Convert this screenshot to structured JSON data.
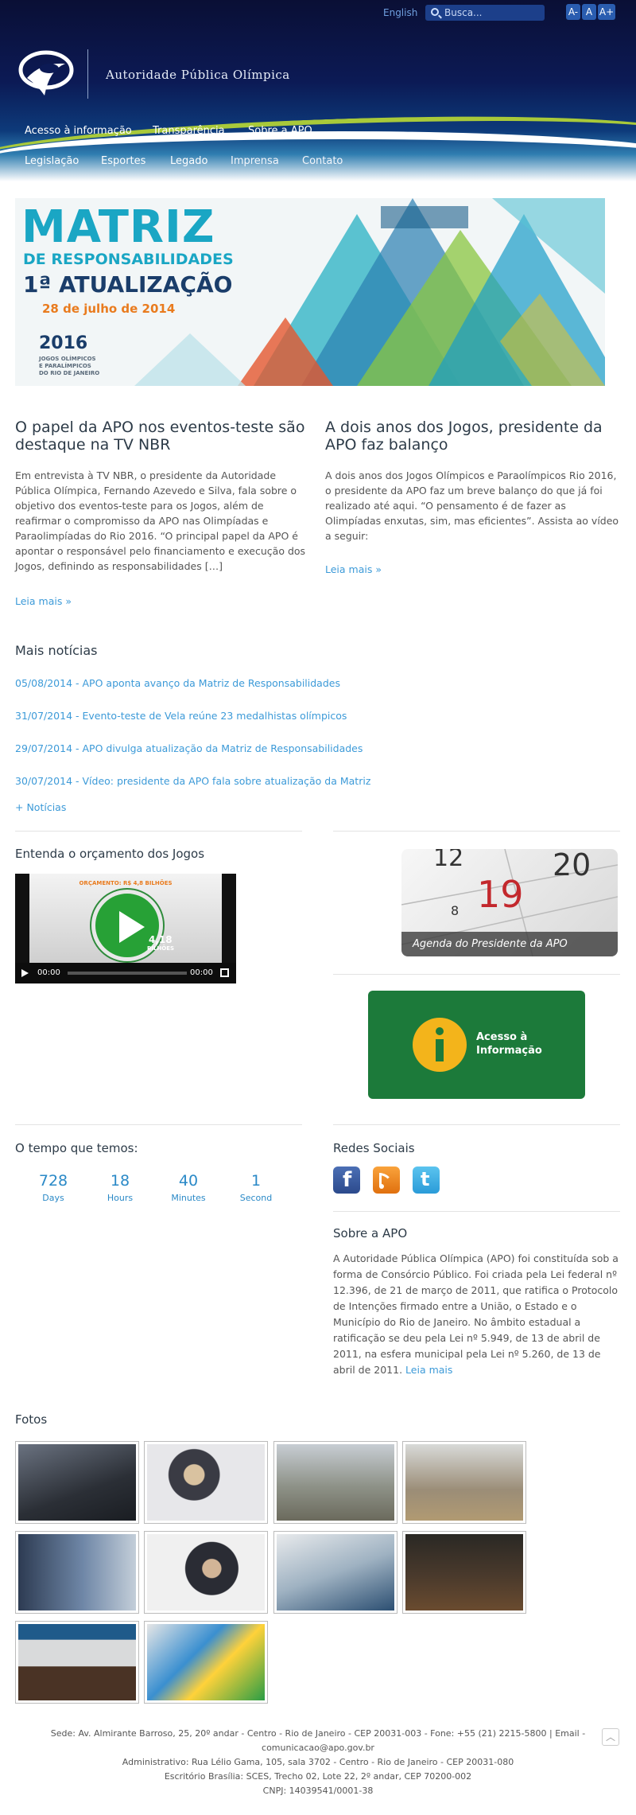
{
  "header": {
    "lang_link": "English",
    "search_placeholder": "Busca...",
    "font_sizes": [
      "A-",
      "A",
      "A+"
    ],
    "org_name": "Autoridade Pública Olímpica",
    "nav_row1": [
      "Acesso à informação",
      "Transparência",
      "Sobre a APO"
    ],
    "nav_row2": [
      "Legislação",
      "Esportes",
      "Legado",
      "Imprensa",
      "Contato"
    ]
  },
  "banner": {
    "title1": "MATRIZ",
    "title2": "DE RESPONSABILIDADES",
    "title3": "1ª ATUALIZAÇÃO",
    "date": "28 de julho de 2014",
    "year": "2016",
    "sub1": "JOGOS OLÍMPICOS",
    "sub2": "E PARALÍMPICOS",
    "sub3": "DO RIO DE JANEIRO"
  },
  "posts": [
    {
      "title": "O papel da APO nos eventos-teste são destaque na TV NBR",
      "body": "Em entrevista à TV NBR,  o presidente da Autoridade Pública Olímpica, Fernando Azevedo e Silva, fala sobre o objetivo dos eventos-teste para os Jogos, além de reafirmar o compromisso da APO nas Olimpíadas e Paraolimpíadas do Rio 2016. “O principal papel da APO é apontar o responsável pelo financiamento e execução dos Jogos, definindo as responsabilidades […]",
      "more": "Leia mais »"
    },
    {
      "title": "A dois anos dos Jogos, presidente da APO faz balanço",
      "body": "A dois anos dos Jogos Olímpicos e Paraolímpicos Rio 2016, o presidente da APO faz um breve balanço do que já foi realizado até aqui. “O pensamento é de fazer as Olimpíadas enxutas, sim, mas eficientes”. Assista ao vídeo a seguir:",
      "more": "Leia mais »"
    }
  ],
  "news": {
    "title": "Mais notícias",
    "items": [
      "05/08/2014 - APO aponta avanço da Matriz de Responsabilidades",
      "31/07/2014 - Evento-teste de Vela reúne 23 medalhistas olímpicos",
      "29/07/2014 - APO divulga atualização da Matriz de Responsabilidades",
      "30/07/2014 - Vídeo: presidente da APO fala sobre atualização da Matriz"
    ],
    "more": "+ Notícias"
  },
  "video": {
    "title": "Entenda o orçamento dos Jogos",
    "overlay_top": "ORÇAMENTO: R$ 4,8 BILHÕES",
    "overlay_value": "4,18",
    "overlay_unit": "BILHÕES",
    "time_current": "00:00",
    "time_total": "00:00"
  },
  "agenda": {
    "label": "Agenda do Presidente da APO",
    "nums": [
      "12",
      "20",
      "8",
      "19"
    ]
  },
  "acesso": {
    "line1": "Acesso à",
    "line2": "Informação"
  },
  "countdown": {
    "title": "O tempo que temos:",
    "items": [
      {
        "value": "728",
        "label": "Days"
      },
      {
        "value": "18",
        "label": "Hours"
      },
      {
        "value": "40",
        "label": "Minutes"
      },
      {
        "value": "1",
        "label": "Second"
      }
    ]
  },
  "social": {
    "title": "Redes Sociais",
    "icons": [
      "facebook-icon",
      "rss-icon",
      "twitter-icon"
    ]
  },
  "about": {
    "title": "Sobre a APO",
    "text": "A Autoridade Pública Olímpica (APO) foi constituída sob a forma de Consórcio Público. Foi criada pela Lei federal nº 12.396, de 21 de março de 2011, que ratifica o Protocolo de Intenções firmado entre a União, o Estado e o Município do Rio de Janeiro. No âmbito estadual a ratificação se deu pela Lei nº 5.949, de 13 de abril de 2011, na esfera municipal pela Lei nº 5.260, de 13 de abril de 2011.",
    "more": "Leia mais"
  },
  "photos": {
    "title": "Fotos"
  },
  "footer": {
    "line1": "Sede: Av. Almirante Barroso, 25, 20º andar - Centro - Rio de Janeiro - CEP 20031-003 - Fone: +55 (21) 2215-5800  | Email - comunicacao@apo.gov.br",
    "line2": "Administrativo: Rua Lélio Gama, 105, sala 3702 - Centro - Rio de Janeiro - CEP 20031-080",
    "line3": "Escritório Brasília: SCES, Trecho 02, Lote 22, 2º andar, CEP 70200-002",
    "line4": "CNPJ: 14039541/0001-38"
  },
  "colors": {
    "link": "#3c9ad8",
    "header_dark": "#0a0f35",
    "acesso_green": "#1c7a3a"
  }
}
